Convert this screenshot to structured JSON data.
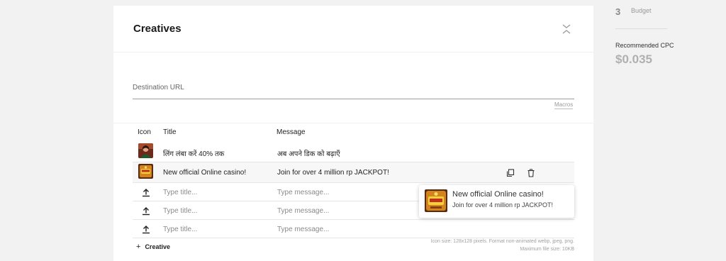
{
  "creatives": {
    "title": "Creatives",
    "destination_url": {
      "label": "Destination URL",
      "value": ""
    },
    "macros_link": "Macros",
    "table": {
      "headers": {
        "icon": "Icon",
        "title": "Title",
        "message": "Message"
      },
      "rows": [
        {
          "icon": "hindi-ad-thumbnail",
          "title": "लिंग लंबा करें 40% तक",
          "message": "अब अपने डिक को बढ़ाएँ"
        },
        {
          "icon": "casino-ad-thumbnail",
          "title": "New official Online casino!",
          "message": "Join for over 4 million rp JACKPOT!"
        },
        {
          "icon": "upload-icon",
          "title_placeholder": "Type title...",
          "message_placeholder": "Type message..."
        },
        {
          "icon": "upload-icon",
          "title_placeholder": "Type title...",
          "message_placeholder": "Type message..."
        },
        {
          "icon": "upload-icon",
          "title_placeholder": "Type title...",
          "message_placeholder": "Type message..."
        }
      ]
    },
    "add_creative_label": "Creative",
    "hint_line1": "Icon size: 128x128 pixels. Format non-animated webp, jpeg, png.",
    "hint_line2": "Maximum file size: 10KB",
    "preview": {
      "title": "New official Online casino!",
      "message": "Join for over 4 million rp JACKPOT!"
    }
  },
  "sidebar": {
    "step_number": "3",
    "step_label": "Budget",
    "cpc_label": "Recommended CPC",
    "cpc_value": "$0.035"
  },
  "colors": {
    "background": "#f2f2f2",
    "card": "#ffffff",
    "muted_text": "#8a8a8a",
    "cpc_value": "#b0b0b0"
  }
}
